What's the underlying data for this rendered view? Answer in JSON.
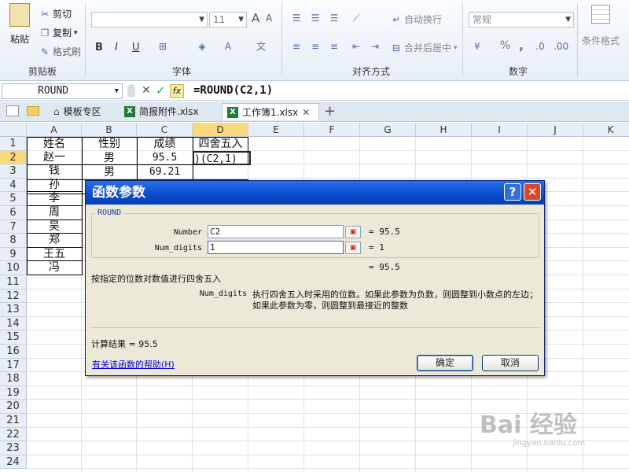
{
  "ribbon": {
    "clipboard": {
      "paste": "粘贴",
      "cut": "剪切",
      "copy": "复制",
      "copy_caret": "▾",
      "format_painter": "格式刷",
      "group": "剪贴板"
    },
    "font": {
      "font_name": "",
      "font_size": "11",
      "bold": "B",
      "italic": "I",
      "underline": "U",
      "group": "字体"
    },
    "alignment": {
      "wrap_text": "自动换行",
      "merge_center": "合并后居中",
      "group": "对齐方式"
    },
    "number": {
      "format": "常规",
      "percent": "%",
      "comma": ",",
      "group": "数字"
    },
    "styles": {
      "conditional_format": "条件格式"
    }
  },
  "formula_bar": {
    "name_box": "ROUND",
    "formula": "=ROUND(C2,1)",
    "fx": "fx"
  },
  "tabs": [
    {
      "label": "模板专区"
    },
    {
      "label": "简报附件.xlsx"
    },
    {
      "label": "工作簿1.xlsx"
    }
  ],
  "columns": [
    "A",
    "B",
    "C",
    "D",
    "E",
    "F",
    "G",
    "H",
    "I",
    "J",
    "K"
  ],
  "rows": [
    "1",
    "2",
    "3",
    "4",
    "5",
    "6",
    "7",
    "8",
    "9",
    "10",
    "11",
    "12",
    "13",
    "14",
    "15",
    "16",
    "17",
    "18",
    "19",
    "20",
    "21",
    "22",
    "23",
    "24"
  ],
  "cells": {
    "header": [
      "姓名",
      "性别",
      "成绩",
      "四舍五入"
    ],
    "names": [
      "赵一",
      "钱",
      "孙",
      "李",
      "周",
      "吴",
      "郑",
      "王五",
      "冯"
    ],
    "gender": [
      "男",
      "男"
    ],
    "scores": [
      "95.5",
      "69.21"
    ],
    "d2": ")(C2,1)"
  },
  "dialog": {
    "title": "函数参数",
    "help_icon": "?",
    "close_icon": "✕",
    "function_name": "ROUND",
    "args": [
      {
        "label": "Number",
        "value": "C2",
        "result": "= 95.5"
      },
      {
        "label": "Num_digits",
        "value": "1",
        "result": "= 1"
      }
    ],
    "overall_result": "= 95.5",
    "description": "按指定的位数对数值进行四舍五入",
    "param_name": "Num_digits",
    "param_desc": "执行四舍五入时采用的位数。如果此参数为负数，则圆整到小数点的左边；如果此参数为零，则圆整到最接近的整数",
    "calc_result": "计算结果 =  95.5",
    "help_link": "有关该函数的帮助(H)",
    "ok": "确定",
    "cancel": "取消"
  },
  "watermark": {
    "brand": "Bai 经验",
    "url": "jingyan.baidu.com"
  }
}
